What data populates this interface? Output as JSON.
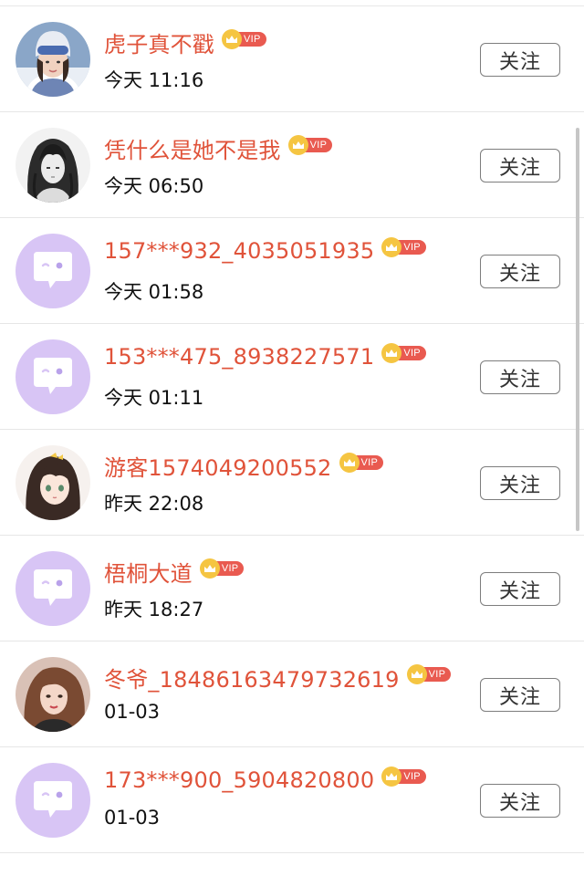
{
  "follow_label": "关注",
  "vip_label": "VIP",
  "colors": {
    "name": "#e0533a",
    "vip_tag": "#e95a50",
    "vip_crown": "#f5c542",
    "default_avatar_bg": "#d8c5f5",
    "default_avatar_bubble": "#ffffff",
    "default_avatar_eye": "#b9a2ea"
  },
  "users": [
    {
      "name": "虎子真不戳",
      "time": "今天 11:16",
      "avatar": "photo-skier"
    },
    {
      "name": "凭什么是她不是我",
      "time": "今天 06:50",
      "avatar": "anime-dark-hair"
    },
    {
      "name": "157***932_4035051935",
      "time": "今天 01:58",
      "avatar": "default-chat-bubble-icon"
    },
    {
      "name": "153***475_8938227571",
      "time": "今天 01:11",
      "avatar": "default-chat-bubble-icon"
    },
    {
      "name": "游客1574049200552",
      "time": "昨天 22:08",
      "avatar": "anime-girl-bow"
    },
    {
      "name": "梧桐大道",
      "time": "昨天 18:27",
      "avatar": "default-chat-bubble-icon"
    },
    {
      "name": "冬爷_18486163479732619",
      "time": "01-03",
      "avatar": "photo-woman"
    },
    {
      "name": "173***900_5904820800",
      "time": "01-03",
      "avatar": "default-chat-bubble-icon"
    }
  ]
}
